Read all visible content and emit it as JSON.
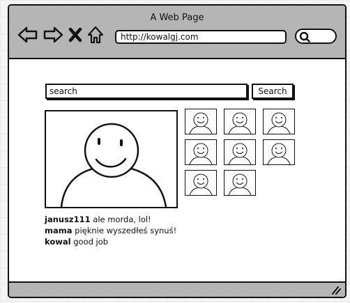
{
  "window": {
    "title": "A Web Page"
  },
  "browser": {
    "url": "http://kowalgj.com",
    "icons": [
      "back-arrow-icon",
      "forward-arrow-icon",
      "close-x-icon",
      "home-icon",
      "search-icon"
    ]
  },
  "search": {
    "placeholder": "search",
    "button_label": "Search"
  },
  "thumbnails_count": 8,
  "comments": [
    {
      "user": "janusz111",
      "text": "ale morda, lol!"
    },
    {
      "user": "mama",
      "text": "pięknie wyszedłeś synuś!"
    },
    {
      "user": "kowal",
      "text": "good job"
    }
  ]
}
